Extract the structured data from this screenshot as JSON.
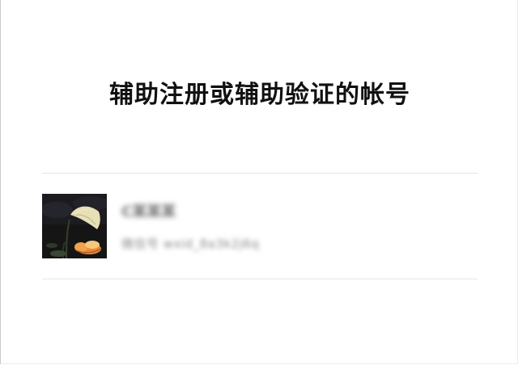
{
  "page": {
    "title": "辅助注册或辅助验证的帐号"
  },
  "account": {
    "name": "C某某某",
    "account_id": "微信号 wxid_8a3k2j6q",
    "avatar_icon": "lotus-leaf-avatar-icon"
  },
  "colors": {
    "title": "#111111",
    "divider": "#e6e6e6",
    "background": "#ffffff"
  }
}
